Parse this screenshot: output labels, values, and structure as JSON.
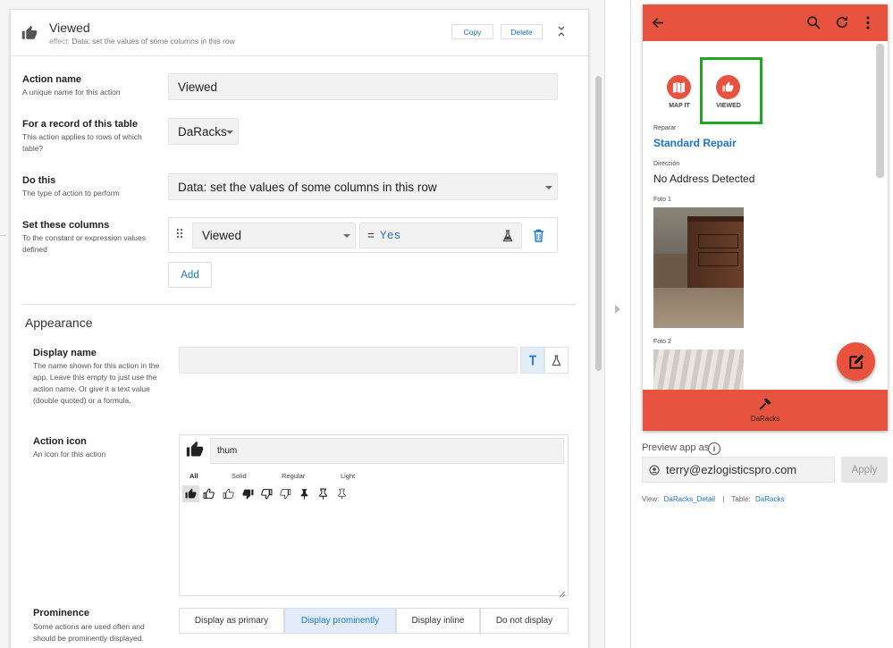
{
  "editor": {
    "header": {
      "title": "Viewed",
      "effect_prefix": "effect:",
      "effect": "Data: set the values of some columns in this row",
      "copy": "Copy",
      "delete": "Delete"
    },
    "action_name": {
      "label": "Action name",
      "help": "A unique name for this action",
      "value": "Viewed"
    },
    "for_record": {
      "label": "For a record of this table",
      "help": "This action applies to rows of which table?",
      "value": "DaRacks"
    },
    "do_this": {
      "label": "Do this",
      "help": "The type of action to perform",
      "value": "Data: set the values of some columns in this row"
    },
    "set_columns": {
      "label": "Set these columns",
      "help": "To the constant or expression values defined",
      "column": "Viewed",
      "eq": "=",
      "expr": "Yes",
      "add": "Add"
    },
    "appearance_title": "Appearance",
    "display_name": {
      "label": "Display name",
      "help": "The name shown for this action in the app. Leave this empty to just use the action name. Or give it a text value (double quoted) or a formula.",
      "value": ""
    },
    "action_icon": {
      "label": "Action icon",
      "help": "An icon for this action",
      "search": "thum",
      "tabs": [
        "All",
        "Solid",
        "Regular",
        "Light"
      ]
    },
    "prominence": {
      "label": "Prominence",
      "help": "Some actions are used often and should be prominently displayed.",
      "options": [
        "Display as primary",
        "Display prominently",
        "Display inline",
        "Do not display"
      ],
      "selected": "Display prominently"
    }
  },
  "preview": {
    "actions": [
      {
        "label": "MAP IT"
      },
      {
        "label": "VIEWED"
      }
    ],
    "fields": {
      "reparar_label": "Reparar",
      "reparar_value": "Standard Repair",
      "direccion_label": "Dirección",
      "direccion_value": "No Address Detected",
      "foto1_label": "Foto 1",
      "foto2_label": "Foto 2"
    },
    "bottom_nav": "DaRacks",
    "preview_as_label": "Preview app as",
    "email": "terry@ezlogisticspro.com",
    "apply": "Apply",
    "view_label": "View:",
    "view_value": "DaRacks_Detail",
    "sep": "|",
    "table_label": "Table:",
    "table_value": "DaRacks"
  },
  "colors": {
    "accent": "#1976d2",
    "app_bar": "#e8533f",
    "highlight_box": "#1fa81f",
    "link": "#1e72c4"
  }
}
